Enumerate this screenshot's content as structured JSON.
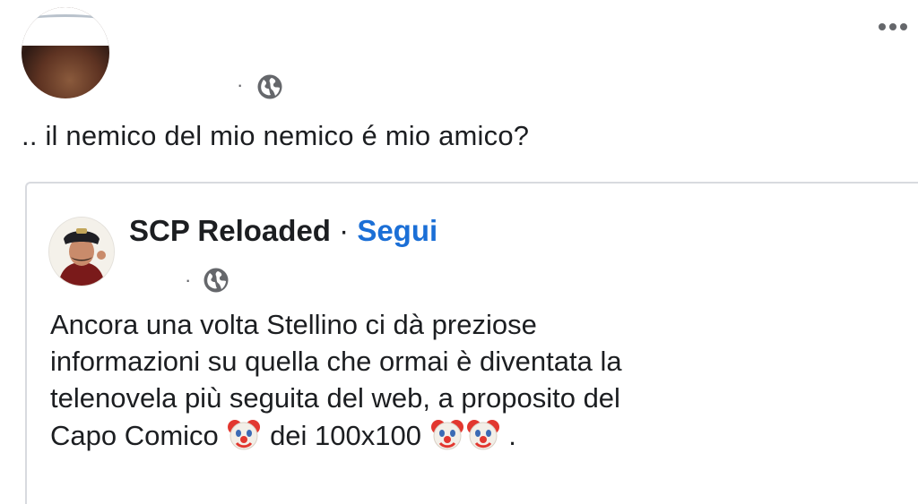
{
  "post": {
    "text": ".. il nemico del mio nemico é mio amico?",
    "separator": "·",
    "privacy_icon": "globe-icon",
    "more_icon": "more-options-icon"
  },
  "shared": {
    "page_name": "SCP Reloaded",
    "separator": "·",
    "follow_label": "Segui",
    "meta_separator": "·",
    "privacy_icon": "globe-icon",
    "lines": [
      "Ancora una volta Stellino ci dà preziose",
      "informazioni su quella che ormai è diventata la",
      "telenovela più seguita del web, a proposito del"
    ],
    "last_line_a": "Capo Comico",
    "last_line_b": "dei 100x100",
    "last_line_end": ".",
    "emoji": "clown-face"
  },
  "colors": {
    "text": "#1c1e21",
    "muted": "#65676b",
    "link": "#1b6fd6",
    "border": "#d8dadf"
  }
}
